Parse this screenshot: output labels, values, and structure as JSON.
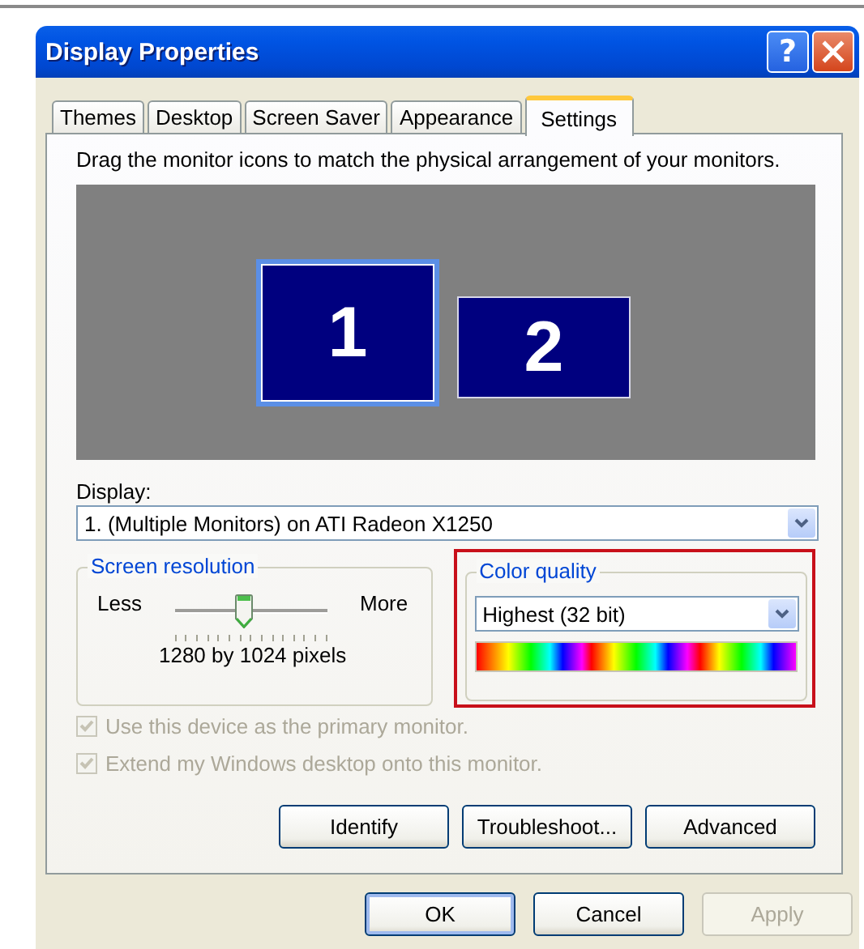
{
  "window": {
    "title": "Display Properties",
    "help_label": "?"
  },
  "tabs": [
    {
      "label": "Themes",
      "selected": false
    },
    {
      "label": "Desktop",
      "selected": false
    },
    {
      "label": "Screen Saver",
      "selected": false
    },
    {
      "label": "Appearance",
      "selected": false
    },
    {
      "label": "Settings",
      "selected": true
    }
  ],
  "instructions": "Drag the monitor icons to match the physical arrangement of your monitors.",
  "monitors": [
    {
      "label": "1",
      "selected": true
    },
    {
      "label": "2",
      "selected": false
    }
  ],
  "display": {
    "label": "Display:",
    "value": "1. (Multiple Monitors) on ATI Radeon X1250"
  },
  "screen_resolution": {
    "title": "Screen resolution",
    "min_label": "Less",
    "max_label": "More",
    "level": 0.45,
    "reading": "1280 by 1024 pixels"
  },
  "color_quality": {
    "title": "Color quality",
    "value": "Highest (32 bit)",
    "highlighted": true
  },
  "options": [
    {
      "label": "Use this device as the primary monitor.",
      "checked": true,
      "disabled": true
    },
    {
      "label": "Extend my Windows desktop onto this monitor.",
      "checked": true,
      "disabled": true
    }
  ],
  "panel_buttons": [
    "Identify",
    "Troubleshoot...",
    "Advanced"
  ],
  "dialog_buttons": [
    {
      "label": "OK",
      "default": true,
      "disabled": false
    },
    {
      "label": "Cancel",
      "default": false,
      "disabled": false
    },
    {
      "label": "Apply",
      "default": false,
      "disabled": true
    }
  ]
}
